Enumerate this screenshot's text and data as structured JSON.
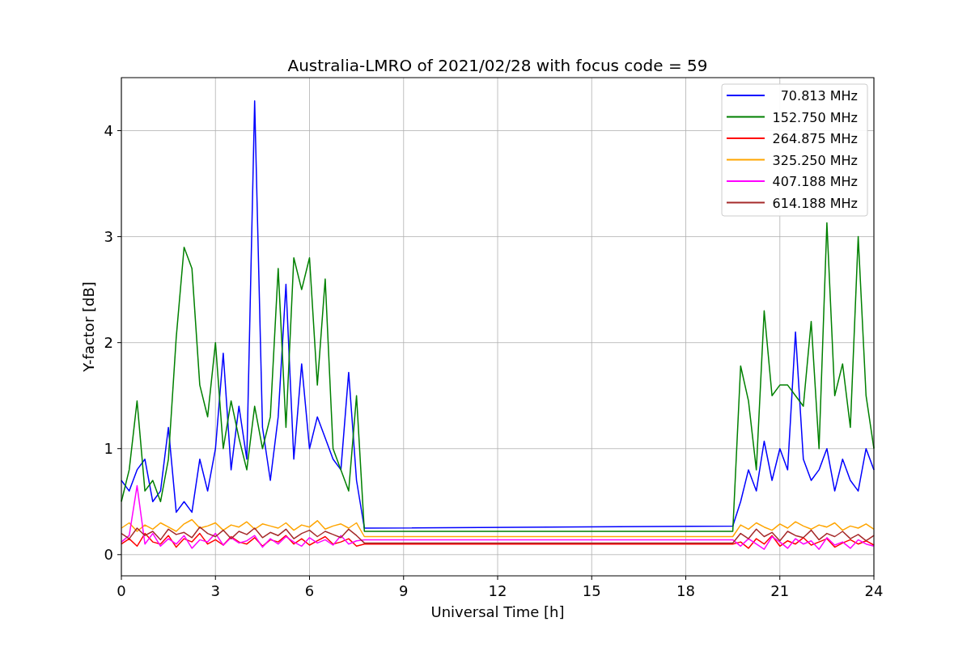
{
  "figure": {
    "chart_data": {
      "type": "line",
      "title": "Australia-LMRO of 2021/02/28 with focus code = 59",
      "xlabel": "Universal Time [h]",
      "ylabel": "Y-factor [dB]",
      "x": [
        0,
        0.25,
        0.5,
        0.75,
        1,
        1.25,
        1.5,
        1.75,
        2,
        2.25,
        2.5,
        2.75,
        3,
        3.25,
        3.5,
        3.75,
        4,
        4.25,
        4.5,
        4.75,
        5,
        5.25,
        5.5,
        5.75,
        6,
        6.25,
        6.5,
        6.75,
        7,
        7.25,
        7.5,
        7.75,
        19.5,
        19.75,
        20,
        20.25,
        20.5,
        20.75,
        21,
        21.25,
        21.5,
        21.75,
        22,
        22.25,
        22.5,
        22.75,
        23,
        23.25,
        23.5,
        23.75,
        24
      ],
      "series": [
        {
          "name": "70.813 MHz",
          "color": "#0000ff",
          "values": [
            0.7,
            0.6,
            0.8,
            0.9,
            0.5,
            0.6,
            1.2,
            0.4,
            0.5,
            0.4,
            0.9,
            0.6,
            1.0,
            1.9,
            0.8,
            1.4,
            0.9,
            4.28,
            1.2,
            0.7,
            1.3,
            2.55,
            0.9,
            1.8,
            1.0,
            1.3,
            1.1,
            0.9,
            0.8,
            1.72,
            0.7,
            0.25,
            0.27,
            0.5,
            0.8,
            0.6,
            1.07,
            0.7,
            1.0,
            0.8,
            2.1,
            0.9,
            0.7,
            0.8,
            1.0,
            0.6,
            0.9,
            0.7,
            0.6,
            1.0,
            0.8
          ]
        },
        {
          "name": "152.750 MHz",
          "color": "#008000",
          "values": [
            0.5,
            0.8,
            1.45,
            0.6,
            0.7,
            0.5,
            0.9,
            2.05,
            2.9,
            2.7,
            1.6,
            1.3,
            2.0,
            1.0,
            1.45,
            1.1,
            0.8,
            1.4,
            1.0,
            1.3,
            2.7,
            1.2,
            2.8,
            2.5,
            2.8,
            1.6,
            2.6,
            1.0,
            0.8,
            0.6,
            1.5,
            0.22,
            0.22,
            1.78,
            1.45,
            0.8,
            2.3,
            1.5,
            1.6,
            1.6,
            1.5,
            1.4,
            2.2,
            1.0,
            3.13,
            1.5,
            1.8,
            1.2,
            3.0,
            1.5,
            1.0
          ]
        },
        {
          "name": "264.875 MHz",
          "color": "#ff0000",
          "values": [
            0.1,
            0.15,
            0.08,
            0.2,
            0.12,
            0.1,
            0.18,
            0.07,
            0.15,
            0.12,
            0.2,
            0.1,
            0.14,
            0.09,
            0.17,
            0.12,
            0.1,
            0.16,
            0.08,
            0.14,
            0.12,
            0.18,
            0.1,
            0.15,
            0.09,
            0.13,
            0.17,
            0.1,
            0.12,
            0.15,
            0.08,
            0.1,
            0.1,
            0.12,
            0.06,
            0.15,
            0.1,
            0.18,
            0.08,
            0.13,
            0.1,
            0.16,
            0.09,
            0.12,
            0.15,
            0.07,
            0.11,
            0.14,
            0.1,
            0.13,
            0.09
          ]
        },
        {
          "name": "325.250 MHz",
          "color": "#ffa500",
          "values": [
            0.25,
            0.3,
            0.22,
            0.28,
            0.24,
            0.3,
            0.26,
            0.22,
            0.29,
            0.33,
            0.25,
            0.27,
            0.3,
            0.23,
            0.28,
            0.26,
            0.31,
            0.24,
            0.29,
            0.27,
            0.25,
            0.3,
            0.23,
            0.28,
            0.26,
            0.32,
            0.24,
            0.27,
            0.29,
            0.25,
            0.3,
            0.17,
            0.17,
            0.28,
            0.24,
            0.3,
            0.26,
            0.23,
            0.29,
            0.25,
            0.31,
            0.27,
            0.24,
            0.28,
            0.26,
            0.3,
            0.23,
            0.27,
            0.25,
            0.29,
            0.24
          ]
        },
        {
          "name": "407.188 MHz",
          "color": "#ff00ff",
          "values": [
            0.12,
            0.18,
            0.65,
            0.1,
            0.2,
            0.08,
            0.15,
            0.1,
            0.18,
            0.06,
            0.14,
            0.12,
            0.2,
            0.09,
            0.16,
            0.11,
            0.13,
            0.18,
            0.07,
            0.15,
            0.1,
            0.17,
            0.12,
            0.08,
            0.16,
            0.11,
            0.14,
            0.09,
            0.18,
            0.1,
            0.13,
            0.14,
            0.14,
            0.08,
            0.15,
            0.1,
            0.05,
            0.17,
            0.12,
            0.06,
            0.15,
            0.1,
            0.13,
            0.05,
            0.16,
            0.09,
            0.12,
            0.06,
            0.14,
            0.1,
            0.08
          ]
        },
        {
          "name": "614.188 MHz",
          "color": "#a52a2a",
          "values": [
            0.2,
            0.15,
            0.25,
            0.18,
            0.22,
            0.14,
            0.24,
            0.19,
            0.21,
            0.16,
            0.26,
            0.2,
            0.17,
            0.23,
            0.15,
            0.22,
            0.19,
            0.25,
            0.16,
            0.21,
            0.18,
            0.24,
            0.15,
            0.2,
            0.23,
            0.17,
            0.22,
            0.19,
            0.16,
            0.24,
            0.18,
            0.11,
            0.11,
            0.2,
            0.15,
            0.24,
            0.17,
            0.21,
            0.13,
            0.22,
            0.18,
            0.16,
            0.23,
            0.14,
            0.2,
            0.17,
            0.22,
            0.15,
            0.19,
            0.13,
            0.18
          ]
        }
      ],
      "grid": true,
      "legend": true,
      "xlim": [
        0,
        24
      ],
      "ylim": [
        -0.2,
        4.5
      ],
      "xticks": [
        0,
        3,
        6,
        9,
        12,
        15,
        18,
        21,
        24
      ],
      "yticks": [
        0,
        1,
        2,
        3,
        4
      ]
    }
  }
}
